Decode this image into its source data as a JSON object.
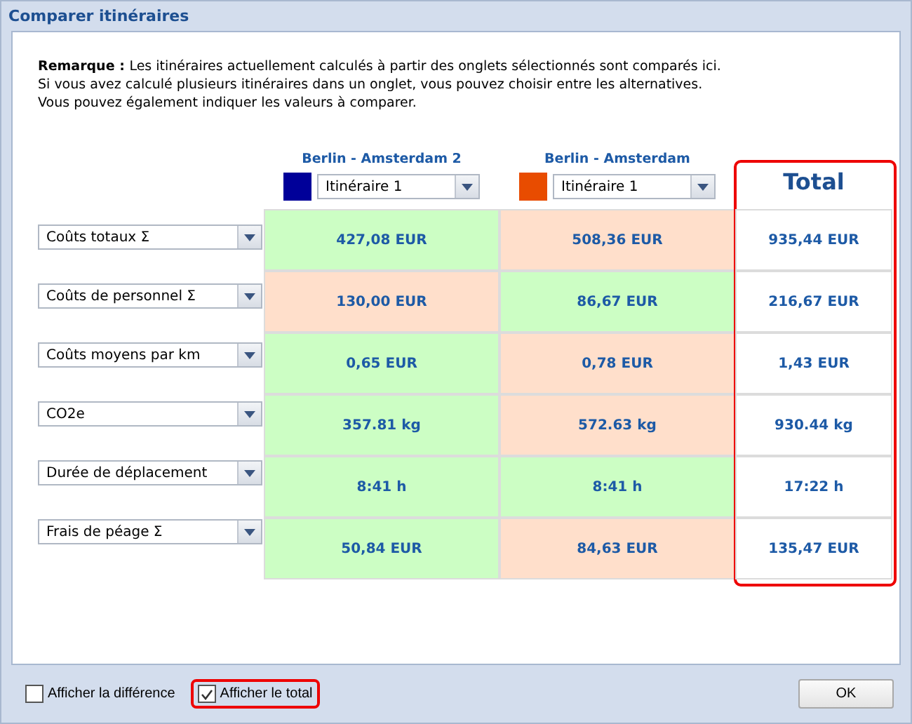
{
  "window": {
    "title": "Comparer itinéraires"
  },
  "note": {
    "lead": "Remarque :",
    "lines": [
      "Les itinéraires actuellement calculés à partir des onglets sélectionnés sont comparés ici.",
      "Si vous avez calculé plusieurs itinéraires dans un onglet, vous pouvez choisir entre les alternatives.",
      "Vous pouvez également indiquer les valeurs à comparer."
    ]
  },
  "routes": [
    {
      "name": "Berlin - Amsterdam 2",
      "color": "#000099",
      "alternative": "Itinéraire 1"
    },
    {
      "name": "Berlin - Amsterdam",
      "color": "#e84c00",
      "alternative": "Itinéraire 1"
    }
  ],
  "total_heading": "Total",
  "rows": [
    {
      "metric": "Coûts totaux Σ",
      "cells": [
        {
          "value": "427,08 EUR",
          "better": true
        },
        {
          "value": "508,36 EUR",
          "better": false
        }
      ],
      "total": "935,44 EUR"
    },
    {
      "metric": "Coûts de personnel Σ",
      "cells": [
        {
          "value": "130,00 EUR",
          "better": false
        },
        {
          "value": "86,67 EUR",
          "better": true
        }
      ],
      "total": "216,67 EUR"
    },
    {
      "metric": "Coûts moyens par km",
      "cells": [
        {
          "value": "0,65 EUR",
          "better": true
        },
        {
          "value": "0,78 EUR",
          "better": false
        }
      ],
      "total": "1,43 EUR"
    },
    {
      "metric": "CO2e",
      "cells": [
        {
          "value": "357.81 kg",
          "better": true
        },
        {
          "value": "572.63 kg",
          "better": false
        }
      ],
      "total": "930.44 kg"
    },
    {
      "metric": "Durée de déplacement",
      "cells": [
        {
          "value": "8:41 h",
          "better": true
        },
        {
          "value": "8:41 h",
          "better": true
        }
      ],
      "total": "17:22 h"
    },
    {
      "metric": "Frais de péage Σ",
      "cells": [
        {
          "value": "50,84 EUR",
          "better": true
        },
        {
          "value": "84,63 EUR",
          "better": false
        }
      ],
      "total": "135,47 EUR"
    }
  ],
  "options": [
    {
      "label": "Afficher la différence",
      "checked": false
    },
    {
      "label": "Afficher le total",
      "checked": true
    }
  ],
  "buttons": [
    "OK"
  ]
}
